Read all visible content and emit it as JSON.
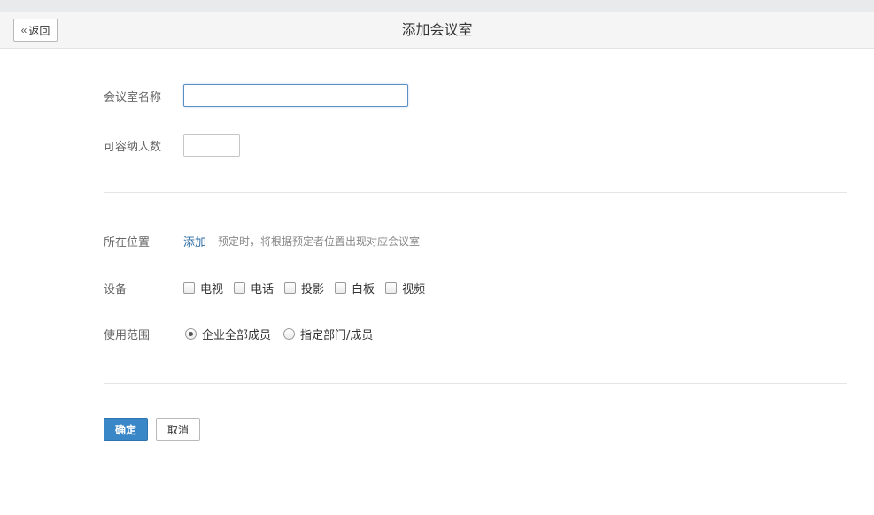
{
  "header": {
    "back_label": "返回",
    "title": "添加会议室"
  },
  "form": {
    "name": {
      "label": "会议室名称",
      "value": ""
    },
    "capacity": {
      "label": "可容纳人数",
      "value": ""
    },
    "location": {
      "label": "所在位置",
      "add_link": "添加",
      "hint": "预定时，将根据预定者位置出现对应会议室"
    },
    "equipment": {
      "label": "设备",
      "items": [
        {
          "label": "电视",
          "checked": false
        },
        {
          "label": "电话",
          "checked": false
        },
        {
          "label": "投影",
          "checked": false
        },
        {
          "label": "白板",
          "checked": false
        },
        {
          "label": "视频",
          "checked": false
        }
      ]
    },
    "scope": {
      "label": "使用范围",
      "options": [
        {
          "label": "企业全部成员",
          "selected": true
        },
        {
          "label": "指定部门/成员",
          "selected": false
        }
      ]
    }
  },
  "actions": {
    "confirm_label": "确定",
    "cancel_label": "取消"
  },
  "colors": {
    "primary": "#3a87c8",
    "link": "#2e6da4",
    "focus_border": "#5b8fc6"
  }
}
